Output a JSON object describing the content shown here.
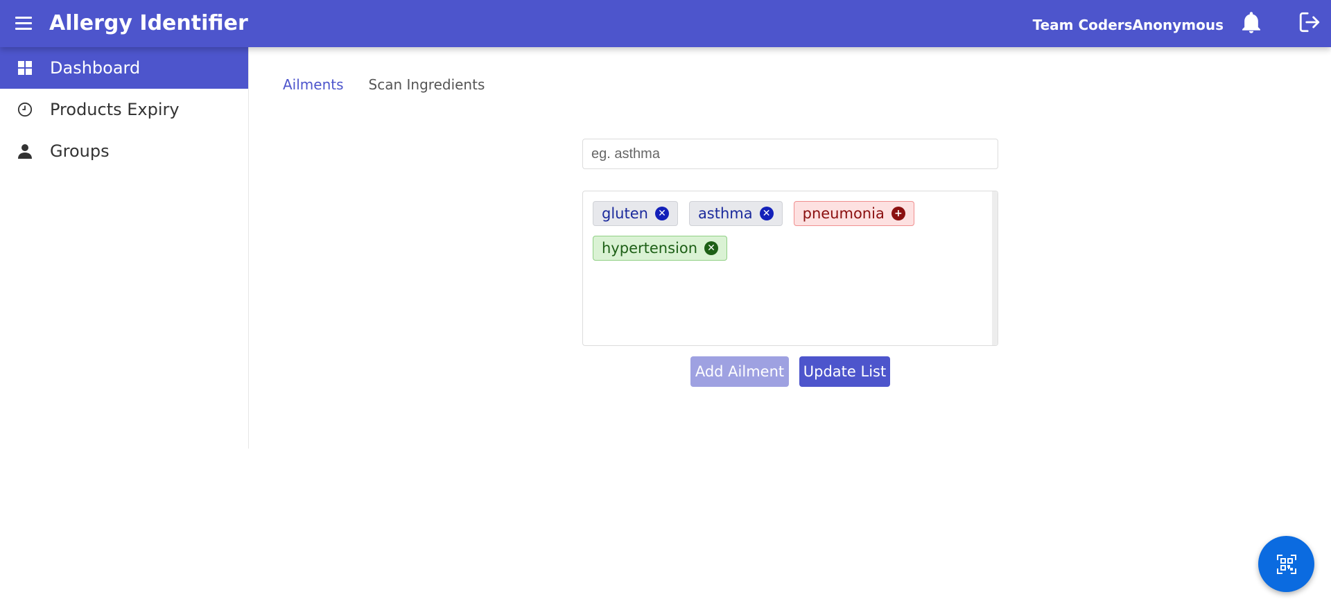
{
  "header": {
    "title": "Allergy Identifier",
    "team": "Team CodersAnonymous",
    "icons": [
      "menu-icon",
      "bell-icon",
      "logout-icon"
    ],
    "color": "#4d55cc"
  },
  "sidebar": {
    "items": [
      {
        "label": "Dashboard",
        "icon": "dashboard-icon",
        "active": true
      },
      {
        "label": "Products Expiry",
        "icon": "clock-icon",
        "active": false
      },
      {
        "label": "Groups",
        "icon": "person-icon",
        "active": false
      }
    ]
  },
  "tabs": [
    {
      "label": "Ailments",
      "active": true
    },
    {
      "label": "Scan Ingredients",
      "active": false
    }
  ],
  "input": {
    "placeholder": "eg. asthma",
    "value": ""
  },
  "tags": [
    {
      "label": "gluten",
      "state": "neutral",
      "icon": "remove-icon"
    },
    {
      "label": "asthma",
      "state": "neutral",
      "icon": "remove-icon"
    },
    {
      "label": "pneumonia",
      "state": "danger",
      "icon": "add-icon"
    },
    {
      "label": "hypertension",
      "state": "success",
      "icon": "remove-icon"
    }
  ],
  "buttons": {
    "add_label": "Add Ailment",
    "update_label": "Update List"
  },
  "fab": {
    "icon": "qr-scan-icon",
    "color": "#0b6be0"
  }
}
